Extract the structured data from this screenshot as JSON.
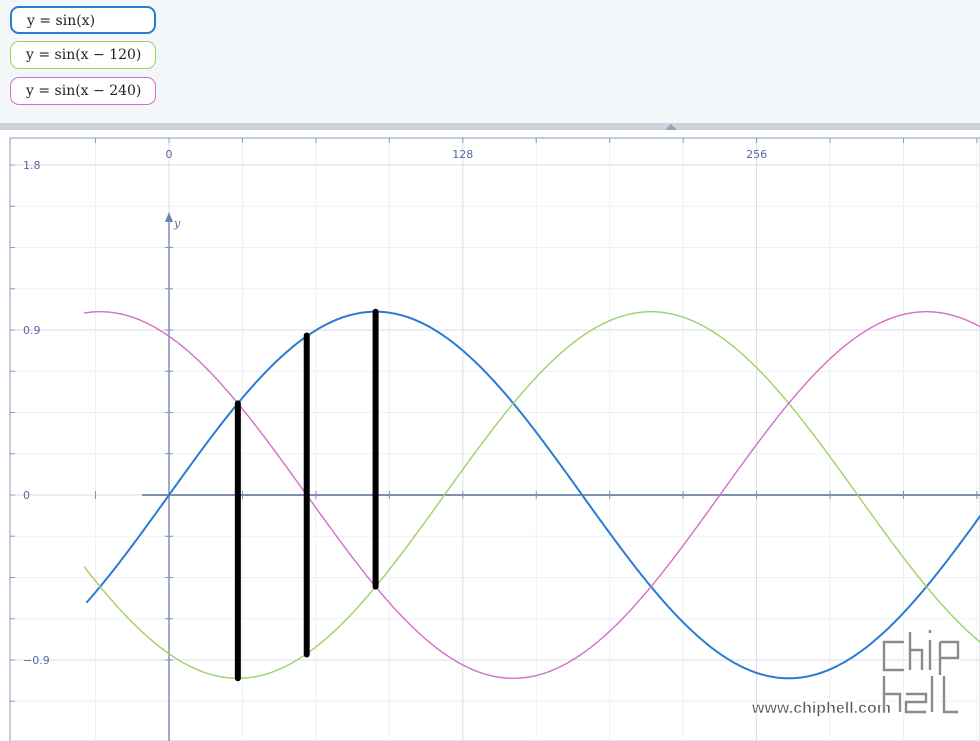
{
  "expressions": [
    {
      "latex": "y = sin(x)",
      "color": "#2a7bd4"
    },
    {
      "latex": "y = sin(x − 120)",
      "color": "#9ed06a"
    },
    {
      "latex": "y = sin(x − 240)",
      "color": "#d070c8"
    }
  ],
  "chart_data": {
    "type": "line",
    "x_ticks": [
      "0",
      "128",
      "256"
    ],
    "y_ticks": [
      "1.8",
      "0.9",
      "0",
      "−0.9"
    ],
    "ylabel": "y",
    "xlim": [
      -73,
      355
    ],
    "ylim": [
      -1.35,
      1.8
    ],
    "grid": true,
    "angle_unit": "degrees",
    "series": [
      {
        "name": "y = sin(x)",
        "color": "#2a7bd4",
        "x_range": [
          -36,
          355
        ],
        "formula": "sin(x)"
      },
      {
        "name": "y = sin(x − 120)",
        "color": "#9ed06a",
        "x_range": [
          -37,
          355
        ],
        "formula": "sin(x-120)"
      },
      {
        "name": "y = sin(x − 240)",
        "color": "#d070c8",
        "x_range": [
          -37,
          355
        ],
        "formula": "sin(x-240)"
      }
    ],
    "annotations": [
      {
        "type": "vertical-bar",
        "color": "#000000",
        "x": 30,
        "y_from": -1.0,
        "y_to": 0.5
      },
      {
        "type": "vertical-bar",
        "color": "#000000",
        "x": 60,
        "y_from": -0.87,
        "y_to": 0.87
      },
      {
        "type": "vertical-bar",
        "color": "#000000",
        "x": 90,
        "y_from": -0.5,
        "y_to": 1.0
      }
    ]
  },
  "watermark": {
    "text": "www.chiphell.com",
    "logo": "chip hell"
  }
}
